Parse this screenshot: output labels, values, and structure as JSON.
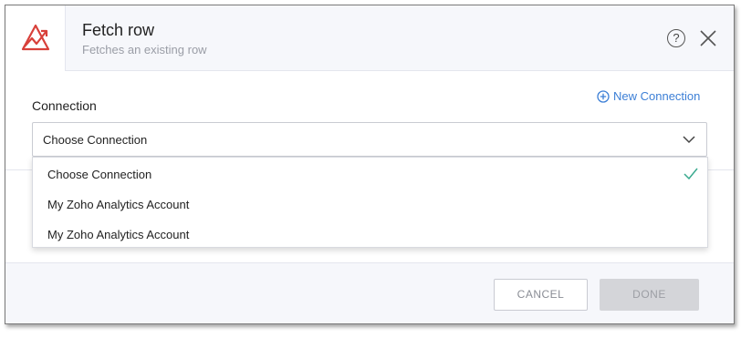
{
  "header": {
    "title": "Fetch row",
    "subtitle": "Fetches an existing row",
    "logo_icon": "zoho-analytics-logo",
    "help_label": "?",
    "accent_color": "#d8403a"
  },
  "connection": {
    "label": "Connection",
    "new_connection_label": "New Connection",
    "selected_value": "Choose Connection"
  },
  "dropdown": {
    "items": [
      {
        "label": "Choose Connection",
        "selected": true
      },
      {
        "label": "My Zoho Analytics Account",
        "selected": false
      },
      {
        "label": "My Zoho Analytics Account",
        "selected": false
      }
    ],
    "check_color": "#3aaa8f"
  },
  "footer": {
    "cancel_label": "CANCEL",
    "done_label": "DONE"
  }
}
